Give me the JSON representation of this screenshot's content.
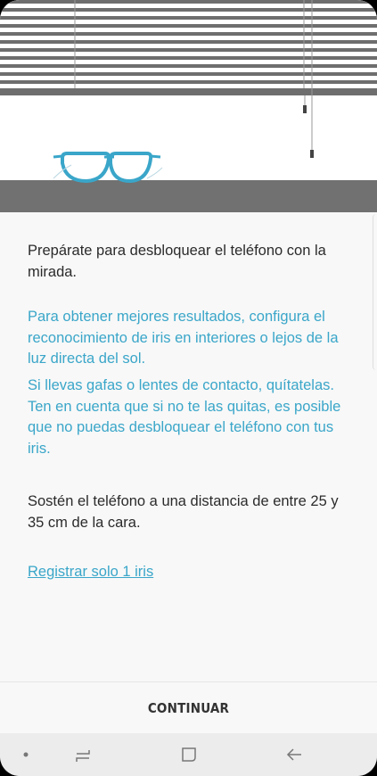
{
  "illustration": {
    "description_icons": [
      "window-blinds-icon",
      "glasses-icon"
    ],
    "colors": {
      "blinds": "#6b6b6b",
      "glasses": "#3aa6c9",
      "floor": "#717171"
    }
  },
  "content": {
    "intro": "Prepárate para desbloquear el teléfono con la mirada.",
    "tip_lighting": "Para obtener mejores resultados, configura el reconocimiento de iris en interiores o lejos de la luz directa del sol.",
    "tip_glasses": "Si llevas gafas o lentes de contacto, quítatelas. Ten en cuenta que si no te las quitas, es posible que no puedas desbloquear el teléfono con tus iris.",
    "distance": "Sostén el teléfono a una distancia de entre 25 y 35 cm de la cara.",
    "register_one_link": "Registrar solo 1 iris"
  },
  "footer": {
    "continue_label": "CONTINUAR"
  },
  "navigation": {
    "items": [
      "dot-indicator-icon",
      "recent-apps-icon",
      "home-icon",
      "back-icon"
    ]
  },
  "colors": {
    "accent": "#3aa6c9",
    "text": "#2b2b2b",
    "background": "#f8f8f8",
    "navbar": "#ececec"
  }
}
